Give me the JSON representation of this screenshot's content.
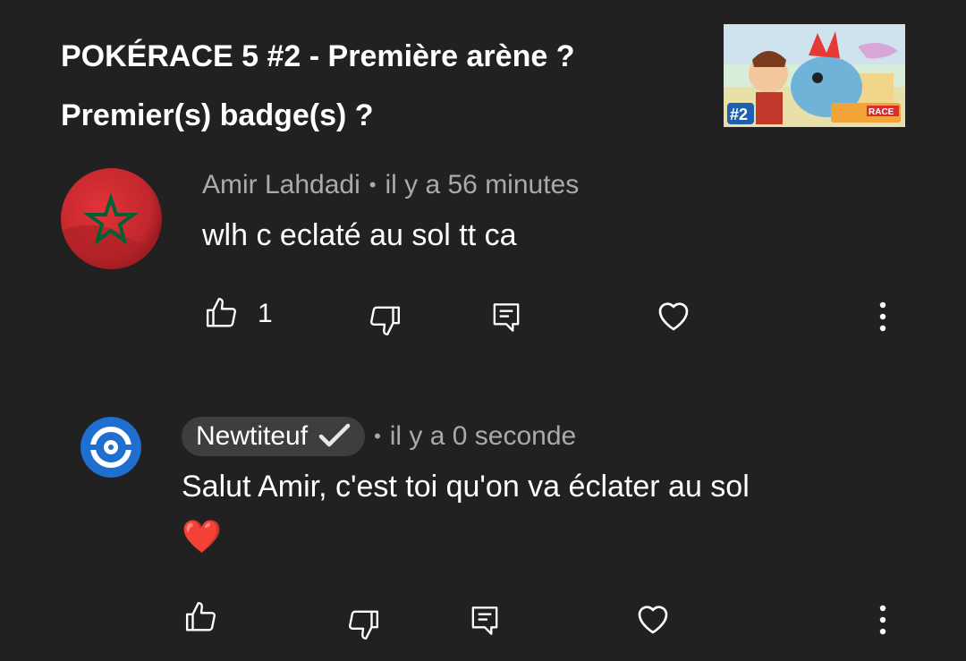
{
  "video": {
    "title": "POKÉRACE 5 #2 - Première arène ? Premier(s) badge(s) ?",
    "thumbnail_badge": "#2",
    "thumbnail_logo": "RACE"
  },
  "comments": [
    {
      "author": "Amir Lahdadi",
      "time": "il y a 56 minutes",
      "text": "wlh c eclaté au sol tt ca",
      "likes": "1",
      "avatar": "morocco-flag"
    }
  ],
  "reply": {
    "author": "Newtiteuf",
    "verified": true,
    "time": "il y a 0 seconde",
    "text": "Salut Amir, c'est toi qu'on va éclater au sol",
    "emoji": "❤️",
    "avatar": "channel-logo"
  },
  "icons": {
    "like": "thumbs-up-icon",
    "dislike": "thumbs-down-icon",
    "reply": "reply-icon",
    "heart": "heart-icon",
    "more": "more-vert-icon"
  },
  "colors": {
    "background": "#212121",
    "secondary_text": "#aaaaaa",
    "badge_bg": "#3e3e3e",
    "channel_blue": "#1e6fd0",
    "flag_red": "#c1272d",
    "flag_green": "#006233",
    "heart_red": "#e0212e"
  }
}
